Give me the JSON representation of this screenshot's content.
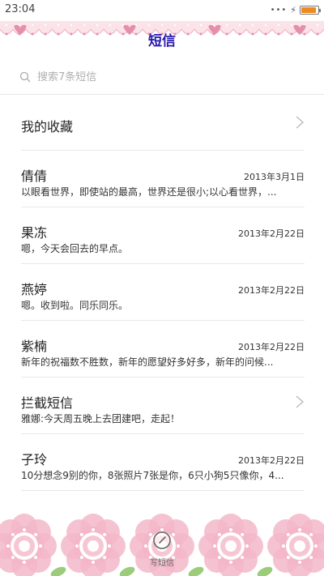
{
  "status_bar": {
    "time": "23:04",
    "battery_level": 0.9,
    "battery_color": "#f08a1c"
  },
  "header": {
    "title": "短信",
    "title_color": "#2a1bb0"
  },
  "search": {
    "placeholder": "搜索7条短信"
  },
  "favorites": {
    "label": "我的收藏"
  },
  "messages": [
    {
      "name": "倩倩",
      "date": "2013年3月1日",
      "snippet": "以眼看世界，即使站的最高，世界还是很小;以心看世界，..."
    },
    {
      "name": "果冻",
      "date": "2013年2月22日",
      "snippet": "嗯，今天会回去的早点。"
    },
    {
      "name": "燕婷",
      "date": "2013年2月22日",
      "snippet": "嗯。收到啦。同乐同乐。"
    },
    {
      "name": "紫楠",
      "date": "2013年2月22日",
      "snippet": "新年的祝福数不胜数，新年的愿望好多好多，新年的问候..."
    },
    {
      "name": "拦截短信",
      "snippet": "雅娜:今天周五晚上去团建吧，走起！"
    },
    {
      "name": "子玲",
      "date": "2013年2月22日",
      "snippet": "10分想念9别的你，8张照片7张是你，6只小狗5只像你，4..."
    }
  ],
  "compose": {
    "label": "写短信"
  },
  "colors": {
    "accent_pink": "#f3b7c9",
    "pink_dark": "#e48fab"
  }
}
